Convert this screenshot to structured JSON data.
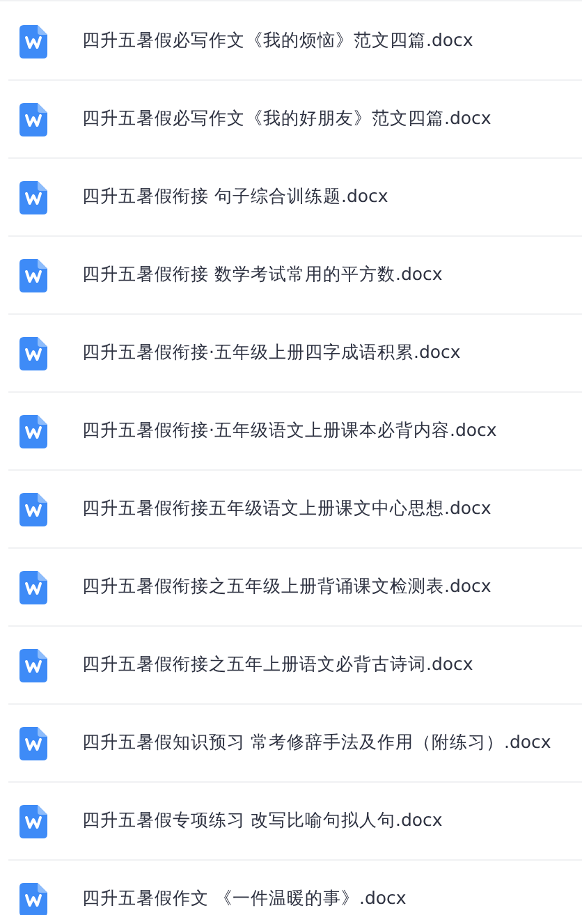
{
  "files": [
    {
      "name": "四升五暑假必写作文《我的烦恼》范文四篇.docx"
    },
    {
      "name": "四升五暑假必写作文《我的好朋友》范文四篇.docx"
    },
    {
      "name": "四升五暑假衔接 句子综合训练题.docx"
    },
    {
      "name": "四升五暑假衔接 数学考试常用的平方数.docx"
    },
    {
      "name": "四升五暑假衔接·五年级上册四字成语积累.docx"
    },
    {
      "name": "四升五暑假衔接·五年级语文上册课本必背内容.docx"
    },
    {
      "name": "四升五暑假衔接五年级语文上册课文中心思想.docx"
    },
    {
      "name": "四升五暑假衔接之五年级上册背诵课文检测表.docx"
    },
    {
      "name": "四升五暑假衔接之五年上册语文必背古诗词.docx"
    },
    {
      "name": "四升五暑假知识预习 常考修辞手法及作用（附练习）.docx"
    },
    {
      "name": "四升五暑假专项练习 改写比喻句拟人句.docx"
    },
    {
      "name": "四升五暑假作文 《一件温暖的事》.docx"
    }
  ]
}
